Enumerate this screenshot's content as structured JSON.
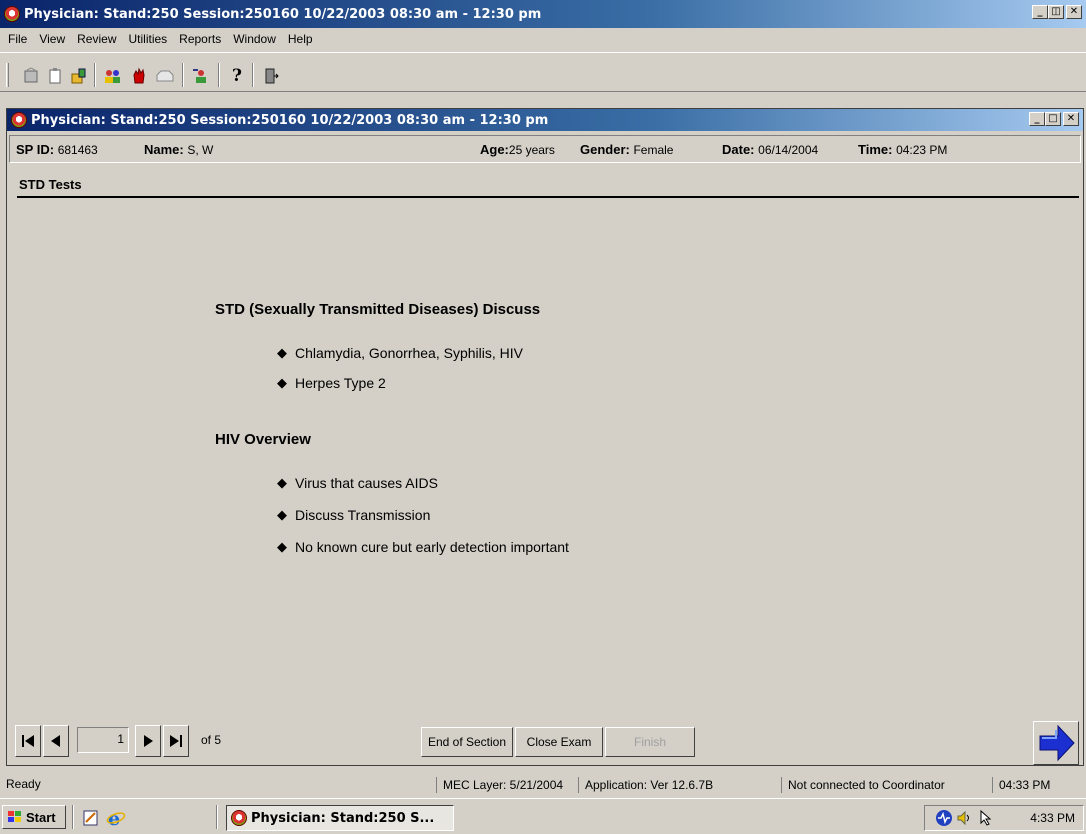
{
  "window": {
    "title": "Physician: Stand:250 Session:250160 10/22/2003 08:30 am - 12:30 pm",
    "buttons": [
      "_",
      "▫",
      "✕"
    ]
  },
  "menu": [
    "File",
    "View",
    "Review",
    "Utilities",
    "Reports",
    "Window",
    "Help"
  ],
  "toolbar": {
    "icons": [
      "new-icon",
      "clipboard-icon",
      "open-icon",
      "people-icon",
      "stop-hand-icon",
      "inbox-icon",
      "user-icon",
      "help-icon",
      "exit-door-icon"
    ]
  },
  "inner_window": {
    "title": "Physician: Stand:250 Session:250160 10/22/2003 08:30 am - 12:30 pm"
  },
  "participant": {
    "sp_id_label": "SP ID:",
    "sp_id": "681463",
    "name_label": "Name:",
    "name": "S, W",
    "age_label": "Age:",
    "age": "25 years",
    "gender_label": "Gender:",
    "gender": "Female",
    "date_label": "Date:",
    "date": "06/14/2004",
    "time_label": "Time:",
    "time": "04:23 PM"
  },
  "section": {
    "title": "STD Tests"
  },
  "content": {
    "heading1": "STD (Sexually Transmitted Diseases) Discuss",
    "list1": [
      "Chlamydia, Gonorrhea, Syphilis, HIV",
      "Herpes Type 2"
    ],
    "heading2": "HIV Overview",
    "list2": [
      "Virus that causes AIDS",
      "Discuss Transmission",
      "No known cure but early detection important"
    ]
  },
  "nav": {
    "page": "1",
    "of_label": "of 5",
    "end_of_section": "End of Section",
    "close_exam": "Close Exam",
    "finish": "Finish"
  },
  "status": {
    "ready": "Ready",
    "mec_layer": "MEC Layer: 5/21/2004",
    "application": "Application: Ver 12.6.7B",
    "coordinator": "Not connected to Coordinator",
    "time": "04:33 PM"
  },
  "taskbar": {
    "start": "Start",
    "task": "Physician: Stand:250 S...",
    "clock": "4:33 PM"
  }
}
